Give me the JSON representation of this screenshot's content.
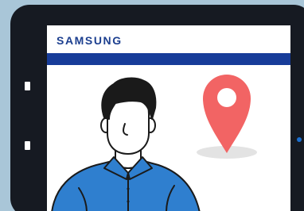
{
  "brand": {
    "name": "SAMSUNG",
    "color": "#1c3f8f"
  },
  "colors": {
    "background": "#a9c6d8",
    "tablet_frame": "#161a22",
    "header_bar": "#173c99",
    "location_pin": "#f26464",
    "shirt": "#2f7fcf",
    "camera_dot": "#1b6fd1"
  },
  "icons": {
    "location_pin": "map-pin-icon",
    "person": "man-avatar"
  }
}
